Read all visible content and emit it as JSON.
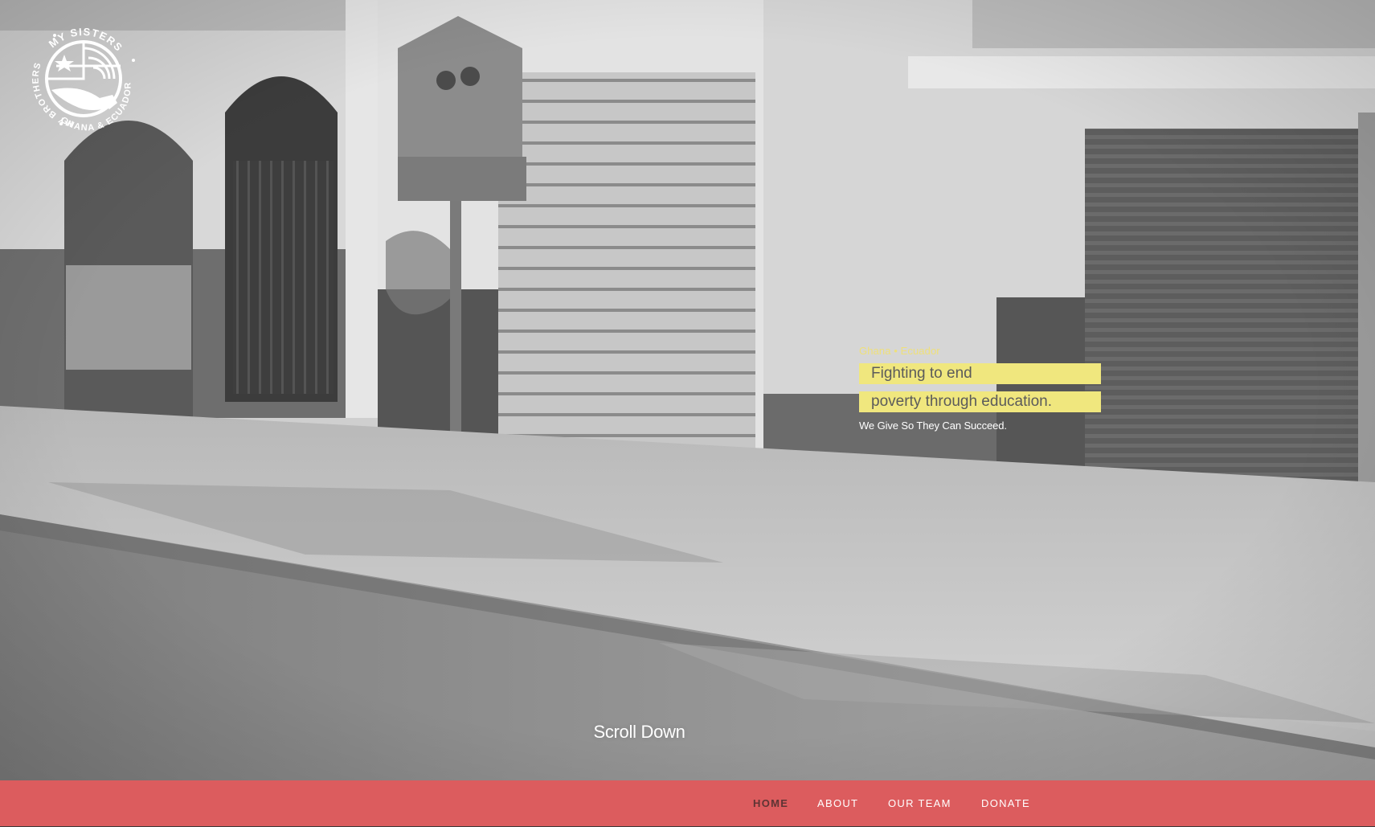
{
  "logo": {
    "text_top": "MY SISTERS",
    "text_left": "MY BROTHERS",
    "text_bottom": "GHANA & ECUADOR"
  },
  "hero": {
    "eyebrow": "Ghana • Ecuador",
    "headline": [
      "Fighting to end",
      "poverty through education."
    ],
    "tagline": "We Give So They Can Succeed.",
    "scroll_label": "Scroll Down"
  },
  "nav": {
    "items": [
      {
        "label": "HOME",
        "active": true
      },
      {
        "label": "ABOUT",
        "active": false
      },
      {
        "label": "OUR TEAM",
        "active": false
      },
      {
        "label": "DONATE",
        "active": false
      }
    ]
  },
  "colors": {
    "nav_bg": "#dc5c5e",
    "highlight": "#f0e77e",
    "eyebrow": "#efe07a",
    "active_nav": "#5e3434"
  }
}
